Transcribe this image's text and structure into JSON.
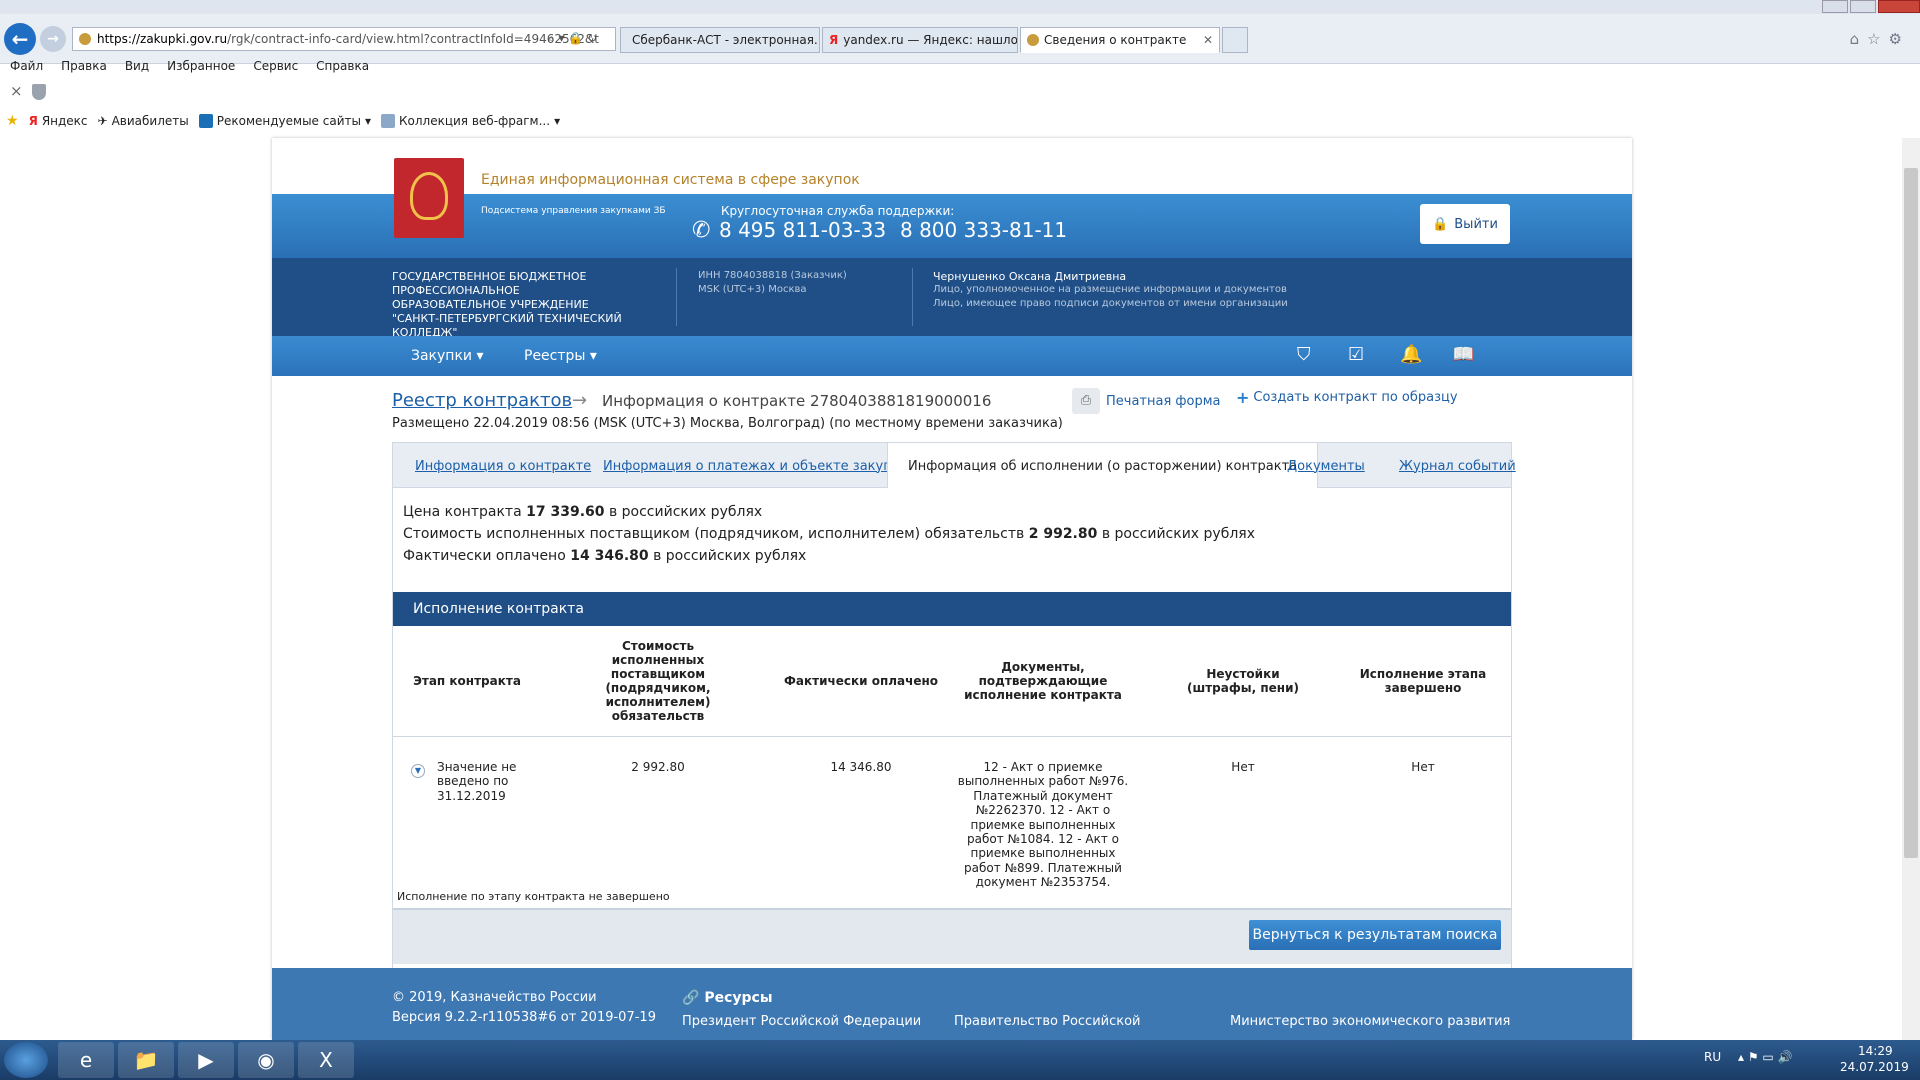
{
  "browser": {
    "url_domain": "https://zakupki.gov.ru",
    "url_rest": "/rgk/contract-info-card/view.html?contractInfoId=49462562&t",
    "tabs": [
      {
        "label": "Сбербанк-АСТ - электронная..."
      },
      {
        "label": "yandex.ru — Яндекс: нашлось..."
      },
      {
        "label": "Сведения о контракте",
        "close": "✕"
      }
    ],
    "menu": [
      "Файл",
      "Правка",
      "Вид",
      "Избранное",
      "Сервис",
      "Справка"
    ],
    "favorites": [
      "Яндекс",
      "Авиабилеты",
      "Рекомендуемые сайты",
      "Коллекция веб-фрагм..."
    ],
    "cmd_close": "×"
  },
  "header": {
    "site_title": "Единая информационная система в сфере закупок",
    "subsystem": "Подсистема управления закупками ЗБ",
    "support_label": "Круглосуточная служба поддержки:",
    "phone1": "8 495 811-03-33",
    "phone2": "8 800 333-81-11",
    "logout": "Выйти",
    "org_name": "ГОСУДАРСТВЕННОЕ БЮДЖЕТНОЕ ПРОФЕССИОНАЛЬНОЕ ОБРАЗОВАТЕЛЬНОЕ УЧРЕЖДЕНИЕ \"САНКТ-ПЕТЕРБУРГСКИЙ ТЕХНИЧЕСКИЙ КОЛЛЕДЖ\"",
    "inn": "ИНН 7804038818 (Заказчик)",
    "tz": "MSK (UTC+3) Москва",
    "user_name": "Чернушенко Оксана Дмитриевна",
    "user_role1": "Лицо, уполномоченное на размещение информации и документов",
    "user_role2": "Лицо, имеющее право подписи документов от имени организации",
    "nav": [
      "Закупки",
      "Реестры"
    ]
  },
  "breadcrumb": {
    "root": "Реестр контрактов",
    "current": "Информация о контракте 2780403881819000016"
  },
  "actions": {
    "print": "Печатная форма",
    "create": "Создать контракт по образцу"
  },
  "placed": "Размещено 22.04.2019 08:56 (MSK (UTC+3) Москва, Волгоград) (по местному времени заказчика)",
  "tabs": [
    "Информация о контракте",
    "Информация о платежах и объекте закупки",
    "Информация об исполнении (о расторжении) контракта",
    "Документы",
    "Журнал событий"
  ],
  "summary": {
    "price_pre": "Цена контракта",
    "price_val": "17 339.60",
    "price_post": "в российских рублях",
    "cost_pre": "Стоимость исполненных поставщиком (подрядчиком, исполнителем) обязательств",
    "cost_val": "2 992.80",
    "cost_post": "в российских рублях",
    "paid_pre": "Фактически оплачено",
    "paid_val": "14 346.80",
    "paid_post": "в российских рублях"
  },
  "section_title": "Исполнение контракта",
  "table": {
    "headers": [
      "Этап контракта",
      "Стоимость исполненных поставщиком (подрядчиком, исполнителем) обязательств",
      "Фактически оплачено",
      "Документы, подтверждающие исполнение контракта",
      "Неустойки (штрафы, пени)",
      "Исполнение этапа завершено"
    ],
    "row": {
      "stage": "Значение не введено по 31.12.2019",
      "cost": "2 992.80",
      "paid": "14 346.80",
      "docs": "12 - Акт о приемке выполненных работ №976. Платежный документ №2262370. 12 - Акт о приемке выполненных работ №1084. 12 - Акт о приемке выполненных работ №899. Платежный документ №2353754.",
      "penalty": "Нет",
      "done": "Нет"
    },
    "note": "Исполнение по этапу контракта не завершено"
  },
  "back_button": "Вернуться к результатам поиска",
  "footer": {
    "copyright": "© 2019, Казначейство России",
    "version": "Версия 9.2.2-r110538#6 от 2019-07-19",
    "resources": "Ресурсы",
    "links": [
      "Президент Российской Федерации",
      "Правительство Российской",
      "Министерство экономического развития"
    ]
  },
  "taskbar": {
    "lang": "RU",
    "time": "14:29",
    "date": "24.07.2019"
  }
}
